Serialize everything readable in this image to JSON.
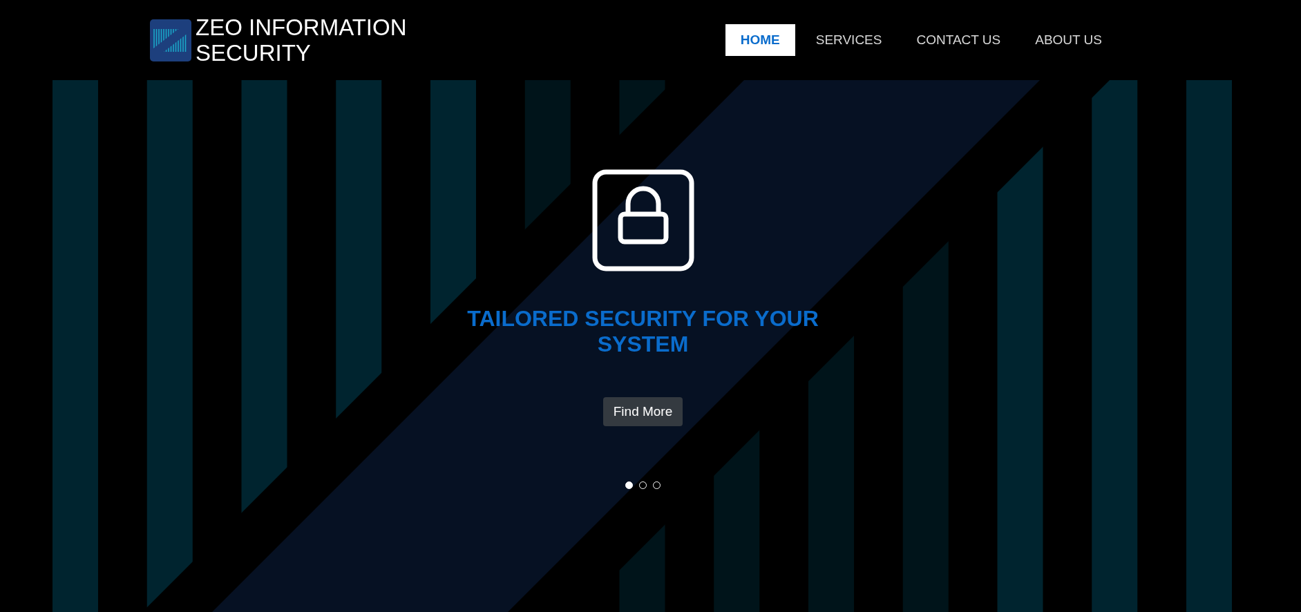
{
  "brand": {
    "name": "ZEO INFORMATION SECURITY"
  },
  "nav": [
    {
      "label": "HOME",
      "selected": true
    },
    {
      "label": "SERVICES",
      "selected": false
    },
    {
      "label": "CONTACT US",
      "selected": false
    },
    {
      "label": "ABOUT US",
      "selected": false
    }
  ],
  "hero": {
    "title": "TAILORED SECURITY FOR YOUR SYSTEM",
    "button": "Find More"
  },
  "carousel_dots": [
    {
      "selected": true
    },
    {
      "selected": false
    },
    {
      "selected": false
    }
  ]
}
